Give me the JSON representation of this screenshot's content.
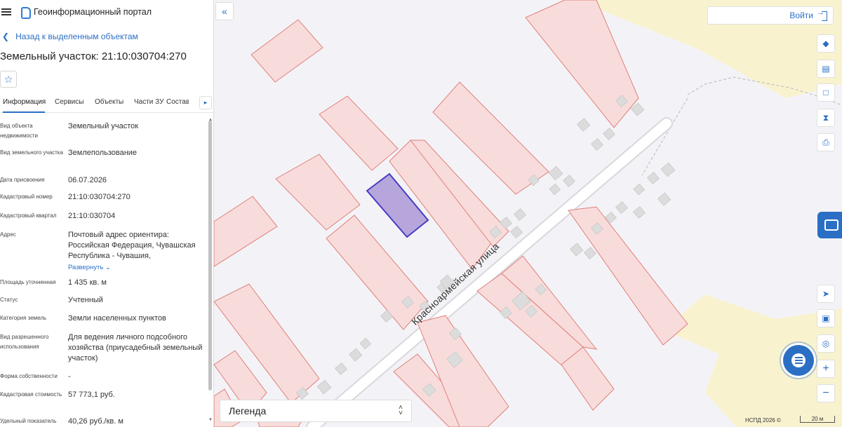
{
  "header": {
    "title": "Геоинформационный портал"
  },
  "nav": {
    "back_label": "Назад к выделенным объектам"
  },
  "object": {
    "title": "Земельный участок: 21:10:030704:270"
  },
  "tabs": [
    {
      "label": "Информация"
    },
    {
      "label": "Сервисы"
    },
    {
      "label": "Объекты"
    },
    {
      "label": "Части ЗУ"
    },
    {
      "label": "Состав"
    }
  ],
  "info": {
    "rows": [
      {
        "label": "Вид объекта недвижимости",
        "value": "Земельный участок"
      },
      {
        "label": "Вид земельного участка",
        "value": "Землепользование"
      },
      {
        "label": "Дата присвоения",
        "value": "06.07.2026"
      },
      {
        "label": "Кадастровый номер",
        "value": "21:10:030704:270"
      },
      {
        "label": "Кадастровый квартал",
        "value": "21:10:030704"
      },
      {
        "label": "Адрес",
        "value": "Почтовый адрес ориентира: Российская Федерация, Чувашская Республика - Чувашия,",
        "action": "Развернуть"
      },
      {
        "label": "Площадь уточненная",
        "value": "1 435 кв. м"
      },
      {
        "label": "Статус",
        "value": "Учтенный"
      },
      {
        "label": "Категория земель",
        "value": "Земли населенных пунктов"
      },
      {
        "label": "Вид разрешенного использования",
        "value": "Для ведения личного подсобного хозяйства (приусадебный земельный участок)"
      },
      {
        "label": "Форма собственности",
        "value": "-"
      },
      {
        "label": "Кадастровая стоимость",
        "value": "57 773,1 руб."
      },
      {
        "label": "Удельный показатель",
        "value": "40,26 руб./кв. м"
      }
    ]
  },
  "map": {
    "street_label": "Красноармейская  улица",
    "login_label": "Войти",
    "legend_label": "Легенда",
    "attribution": "НСПД 2026 ©",
    "scale_label": "20 м",
    "colors": {
      "parcel_fill": "#f8dcdb",
      "parcel_stroke": "#e07f7a",
      "selected_fill": "#b7a6dc",
      "selected_stroke": "#4a3bc4",
      "road": "#ffffff",
      "field": "#f8f2cf",
      "accent": "#2b6fc5"
    }
  }
}
